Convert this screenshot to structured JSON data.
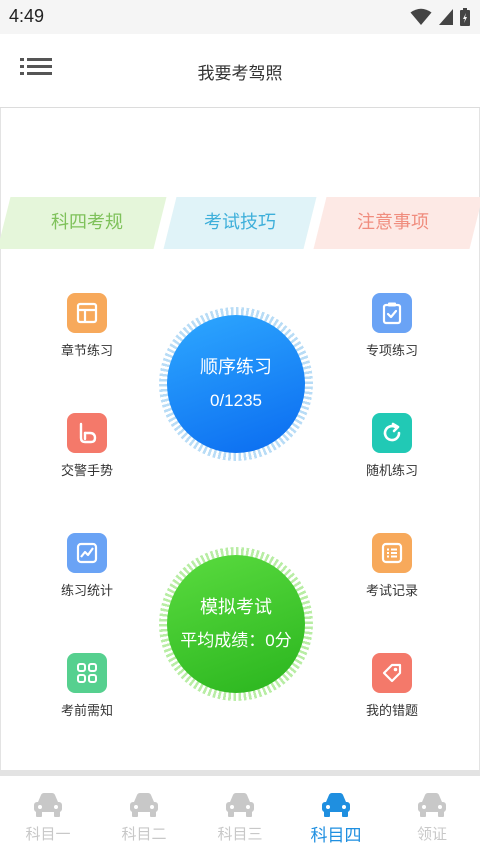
{
  "status_bar": {
    "time": "4:49",
    "icons": [
      "wifi-icon",
      "signal-icon",
      "battery-icon"
    ]
  },
  "header": {
    "menu_icon": "menu-icon",
    "title": "我要考驾照"
  },
  "tabs": [
    {
      "label": "科四考规",
      "color": "#7ec15a"
    },
    {
      "label": "考试技巧",
      "color": "#3eafda"
    },
    {
      "label": "注意事项",
      "color": "#f08d7e"
    }
  ],
  "left_items": [
    {
      "label": "章节练习",
      "icon": "chapter-icon",
      "color": "#f7a95b"
    },
    {
      "label": "交警手势",
      "icon": "gesture-icon",
      "color": "#f4796a"
    },
    {
      "label": "练习统计",
      "icon": "chart-icon",
      "color": "#6aa3f5"
    },
    {
      "label": "考前需知",
      "icon": "grid-icon",
      "color": "#56d08f"
    }
  ],
  "right_items": [
    {
      "label": "专项练习",
      "icon": "clipboard-icon",
      "color": "#6aa3f5"
    },
    {
      "label": "随机练习",
      "icon": "refresh-icon",
      "color": "#21c9b5"
    },
    {
      "label": "考试记录",
      "icon": "record-icon",
      "color": "#f7a95b"
    },
    {
      "label": "我的错题",
      "icon": "tag-icon",
      "color": "#f4796a"
    }
  ],
  "sequential_practice": {
    "title": "顺序练习",
    "progress": "0/1235",
    "color": "#1a8cf7"
  },
  "mock_exam": {
    "title": "模拟考试",
    "score": "平均成绩：0分",
    "color": "#3cc52b"
  },
  "bottom_nav": [
    {
      "label": "科目一",
      "active": false
    },
    {
      "label": "科目二",
      "active": false
    },
    {
      "label": "科目三",
      "active": false
    },
    {
      "label": "科目四",
      "active": true
    },
    {
      "label": "领证",
      "active": false
    }
  ],
  "colors": {
    "nav_active": "#1f8fe0",
    "nav_inactive": "#c8c8c8"
  }
}
